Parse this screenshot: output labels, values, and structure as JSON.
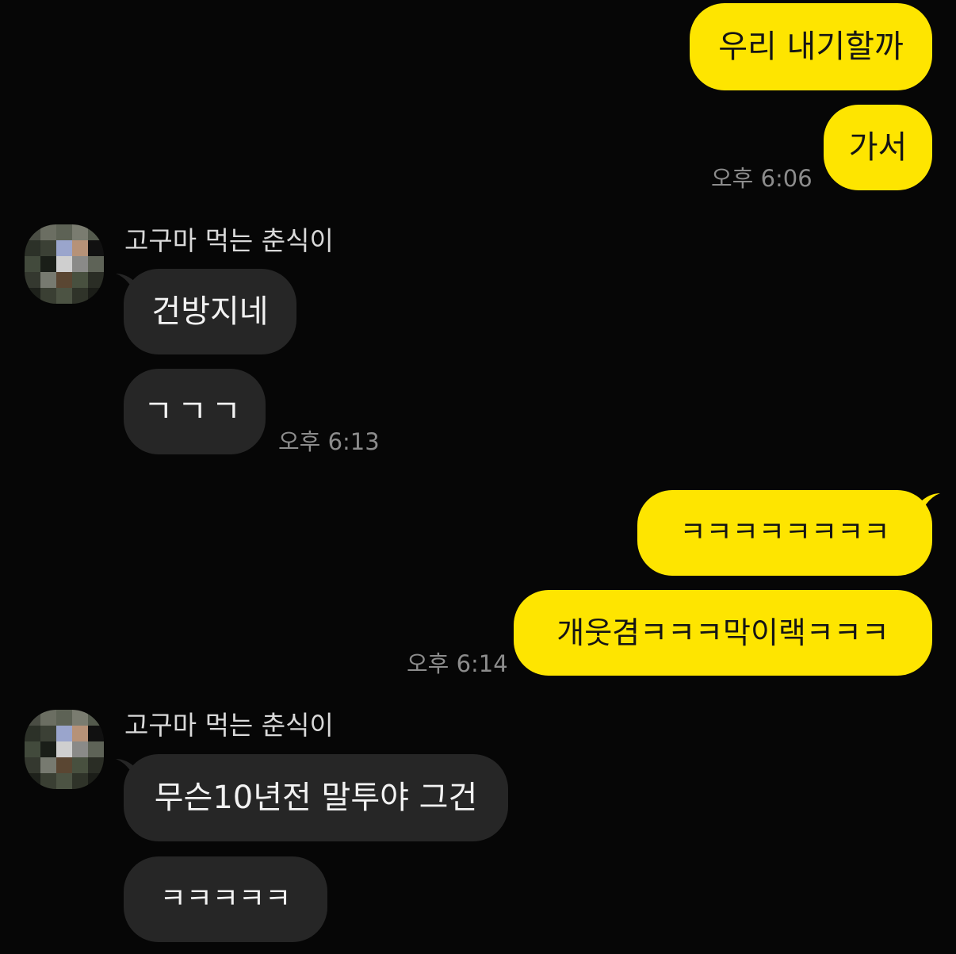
{
  "messages": {
    "m1": "우리 내기할까",
    "m2": "가서",
    "m3": "건방지네",
    "m4": "ㄱㄱㄱ",
    "m5": "ㅋㅋㅋㅋㅋㅋㅋㅋ",
    "m6": "개웃겸ㅋㅋㅋ막이랙ㅋㅋㅋ",
    "m7": "무슨10년전 말투야 그건",
    "m8": "ㅋㅋㅋㅋㅋ"
  },
  "times": {
    "t1": "오후 6:06",
    "t2": "오후 6:13",
    "t3": "오후 6:14"
  },
  "sender": {
    "name": "고구마 먹는 춘식이"
  },
  "colors": {
    "background": "#060606",
    "my_bubble": "#fee500",
    "their_bubble": "#262626",
    "time_text": "#8c8c8c"
  }
}
